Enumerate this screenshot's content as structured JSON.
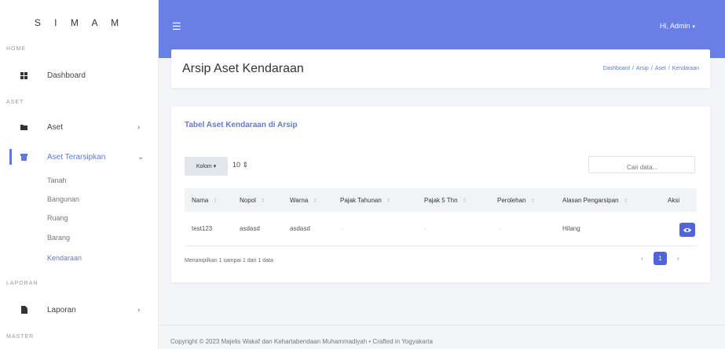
{
  "brand": "S I M A M",
  "sidebar": {
    "sections": {
      "home": "HOME",
      "aset": "ASET",
      "laporan": "LAPORAN",
      "master": "MASTER"
    },
    "items": {
      "dashboard": "Dashboard",
      "aset": "Aset",
      "aset_terarsipkan": "Aset Terarsipkan",
      "laporan": "Laporan"
    },
    "subitems": [
      "Tanah",
      "Bangunan",
      "Ruang",
      "Barang",
      "Kendaraan"
    ],
    "active_subitem": "Kendaraan"
  },
  "topbar": {
    "user_label": "Hi, Admin"
  },
  "page": {
    "title": "Arsip Aset Kendaraan",
    "breadcrumb": [
      "Dashboard",
      "Arsip",
      "Aset",
      "Kendaraan"
    ]
  },
  "table_card": {
    "title": "Tabel Aset Kendaraan di Arsip",
    "kolom_label": "Kolom",
    "page_length": "10",
    "search_placeholder": "Cari data...",
    "columns": [
      "Nama",
      "Nopol",
      "Warna",
      "Pajak Tahunan",
      "Pajak 5 Thn",
      "Perolehan",
      "Alasan Pengarsipan",
      "Aksi"
    ],
    "rows": [
      [
        "test123",
        "asdasd",
        "asdasd",
        "-",
        "-",
        "-",
        "Hilang",
        ""
      ]
    ],
    "info": "Menampilkan 1 sampai 1 dari 1 data",
    "pagination": {
      "prev": "‹",
      "current": "1",
      "next": "›"
    }
  },
  "footer": "Copyright © 2023 Majelis Wakaf dan Kehartabendaan Muhammadiyah  •  Crafted in Yogyakarta",
  "colors": {
    "accent": "#6a7fe6",
    "primary_button": "#4f65d9"
  }
}
